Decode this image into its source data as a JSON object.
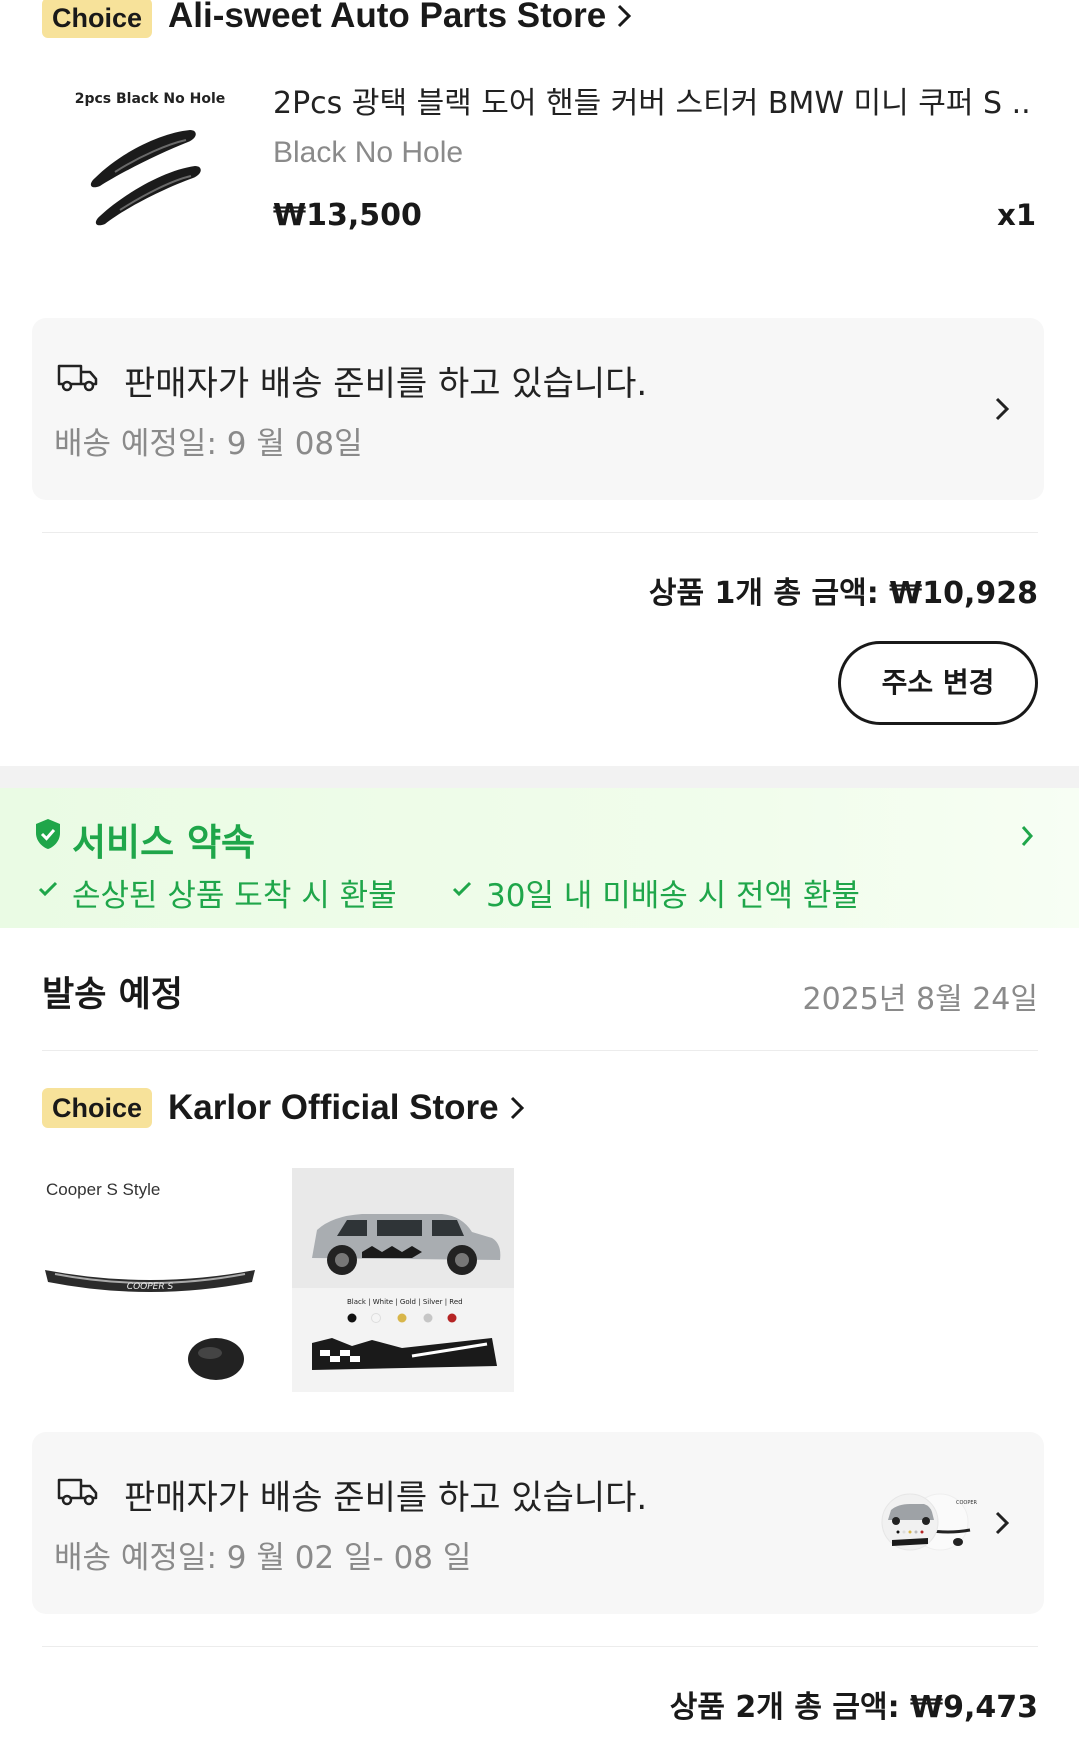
{
  "store1": {
    "badge": "Choice",
    "name": "Ali-sweet Auto Parts Store",
    "product": {
      "image_caption": "2pcs Black No Hole",
      "title": "2Pcs 광택 블랙 도어 핸들 커버 스티커 BMW 미니 쿠퍼 S ...",
      "variant": "Black No Hole",
      "price": "₩13,500",
      "qty": "x1"
    },
    "shipping": {
      "status": "판매자가 배송 준비를 하고 있습니다.",
      "eta": "배송 예정일: 9 월 08일"
    },
    "total": "상품 1개 총 금액: ₩10,928",
    "change_address": "주소 변경"
  },
  "service": {
    "title": "서비스 약속",
    "items": [
      "손상된 상품 도착 시 환불",
      "30일 내 미배송 시 전액 환불"
    ]
  },
  "dispatch": {
    "label": "발송 예정",
    "date": "2025년 8월 24일"
  },
  "store2": {
    "badge": "Choice",
    "name": "Karlor Official Store",
    "product1_caption": "Cooper S Style",
    "product2_swatches": [
      "Black",
      "White",
      "Gold",
      "Silver",
      "Red"
    ],
    "shipping": {
      "status": "판매자가 배송 준비를 하고 있습니다.",
      "eta": "배송 예정일: 9 월 02 일- 08 일"
    },
    "total": "상품 2개 총 금액: ₩9,473"
  },
  "colors": {
    "choice_badge": "#f7e29a",
    "service_green": "#1fa64a",
    "service_bg": "#eefbe9"
  }
}
